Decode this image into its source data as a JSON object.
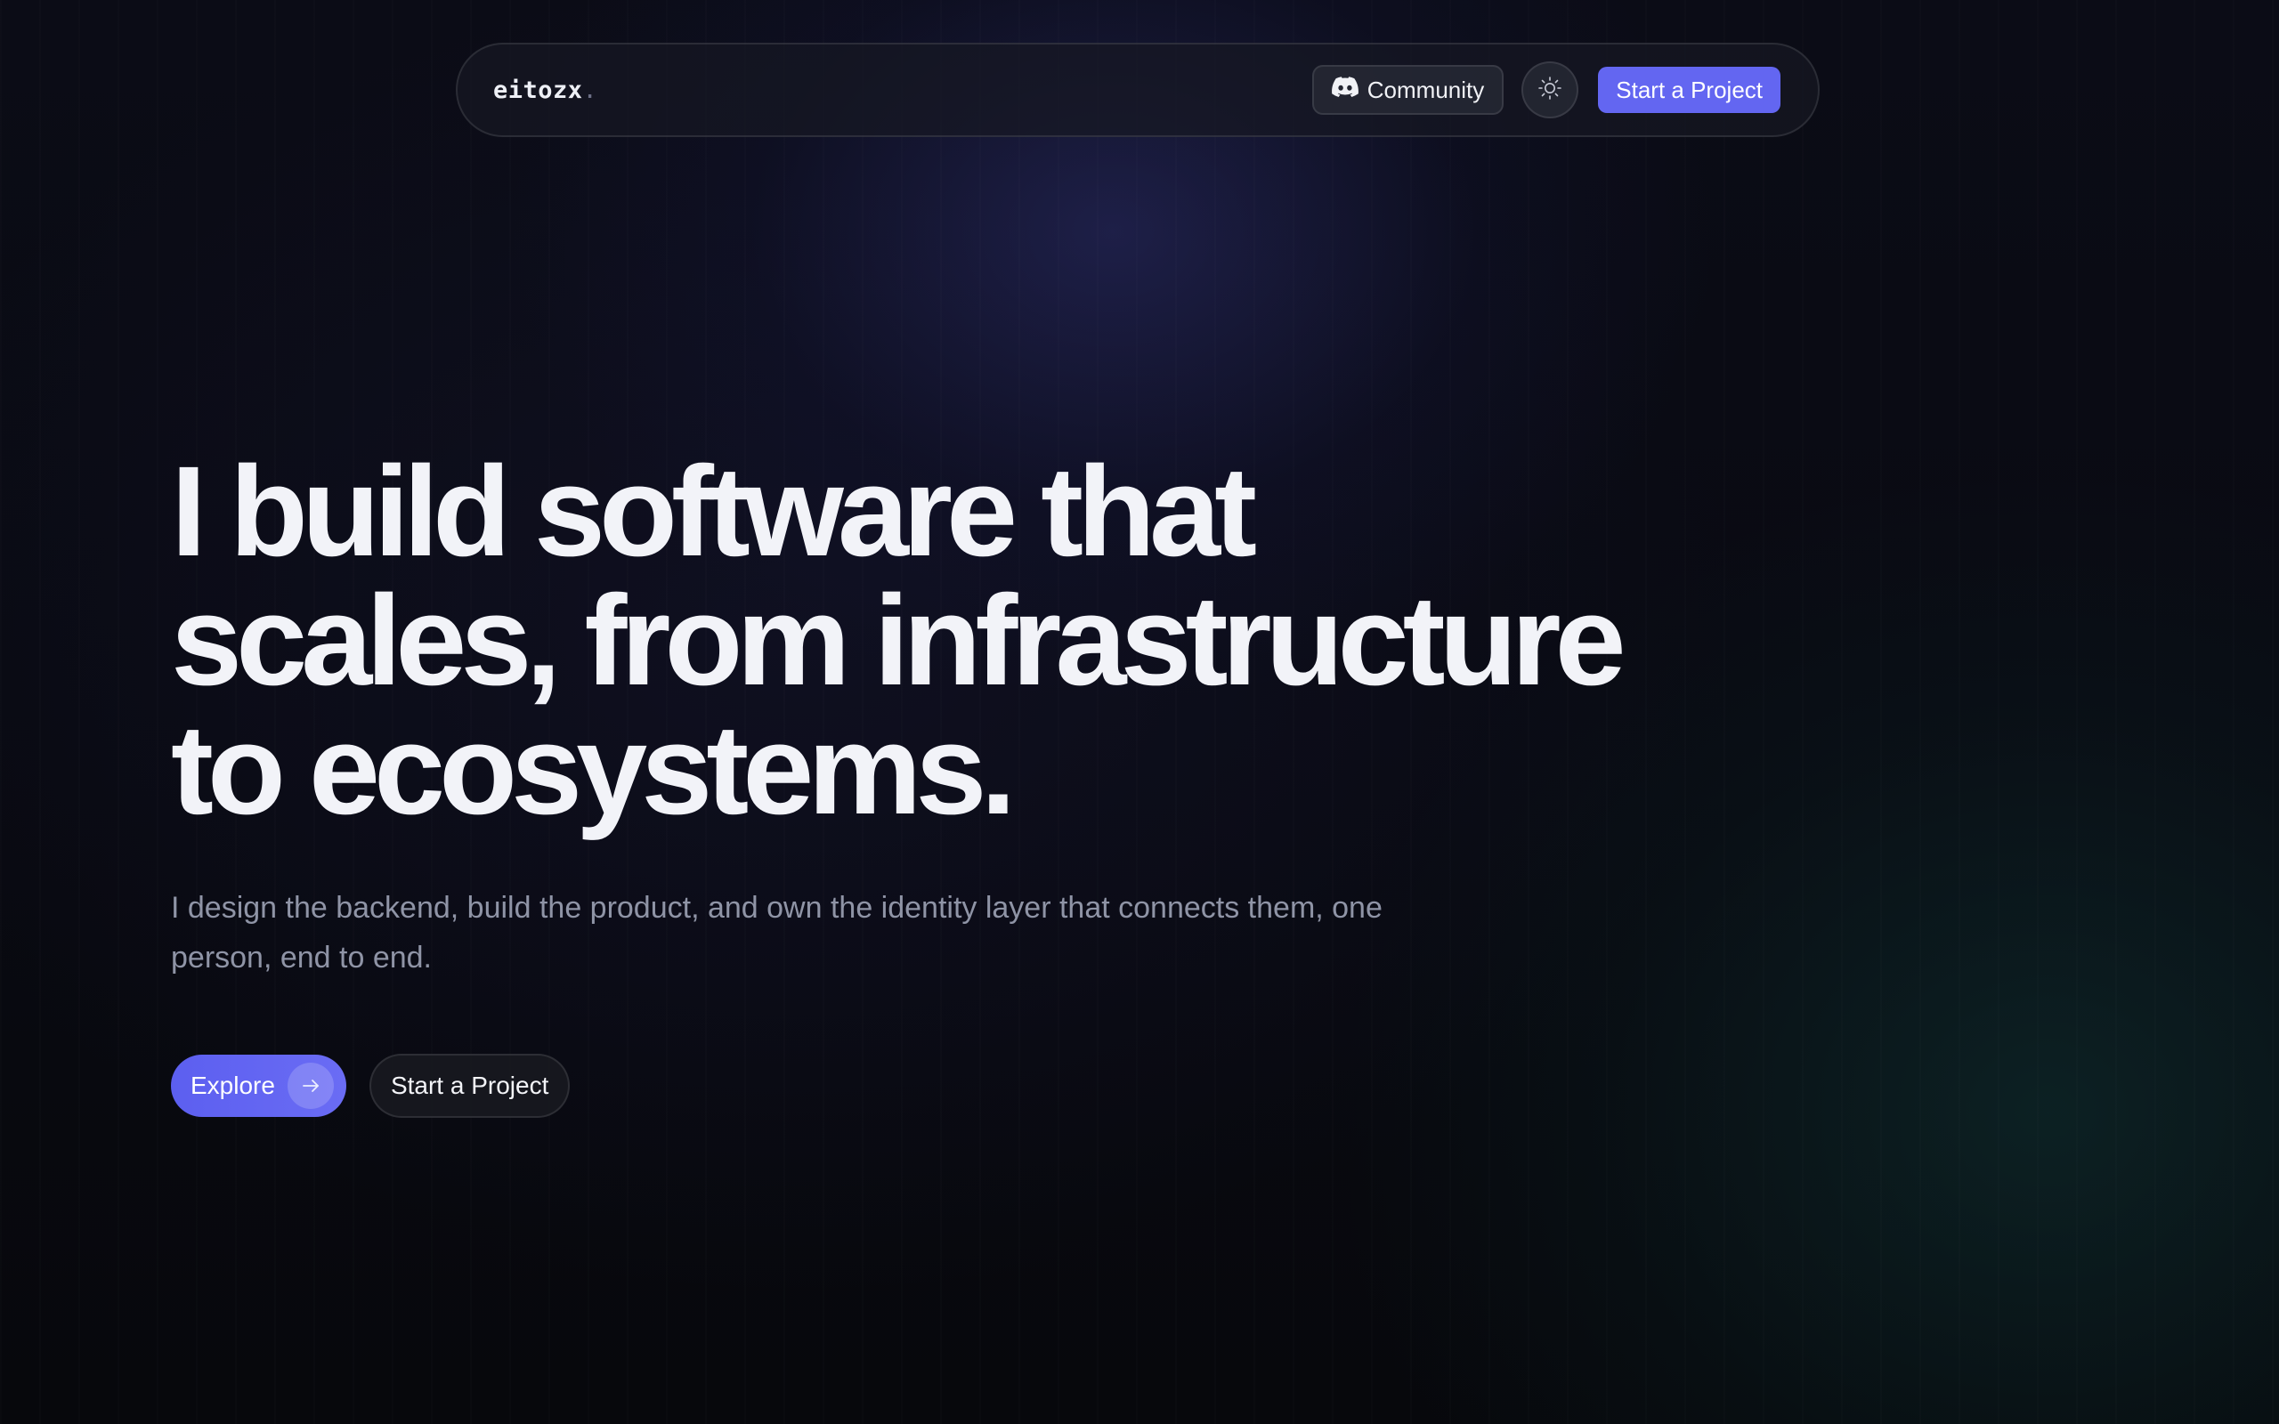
{
  "header": {
    "logo_text": "eitozx",
    "logo_dot": ".",
    "community_label": "Community",
    "community_icon": "discord-icon",
    "theme_icon": "sun-icon",
    "cta_label": "Start a Project"
  },
  "hero": {
    "title_lines": [
      "I build software that",
      "scales, from infrastructure",
      "to ecosystems."
    ],
    "subtitle": "I design the backend, build the product, and own the identity layer that connects them, one person, end to end.",
    "explore_label": "Explore",
    "explore_icon": "arrow-right-icon",
    "secondary_label": "Start a Project"
  },
  "colors": {
    "accent": "#6366f1",
    "background": "#07080c",
    "text": "#f2f3f8",
    "muted_text": "#8f94a6"
  }
}
